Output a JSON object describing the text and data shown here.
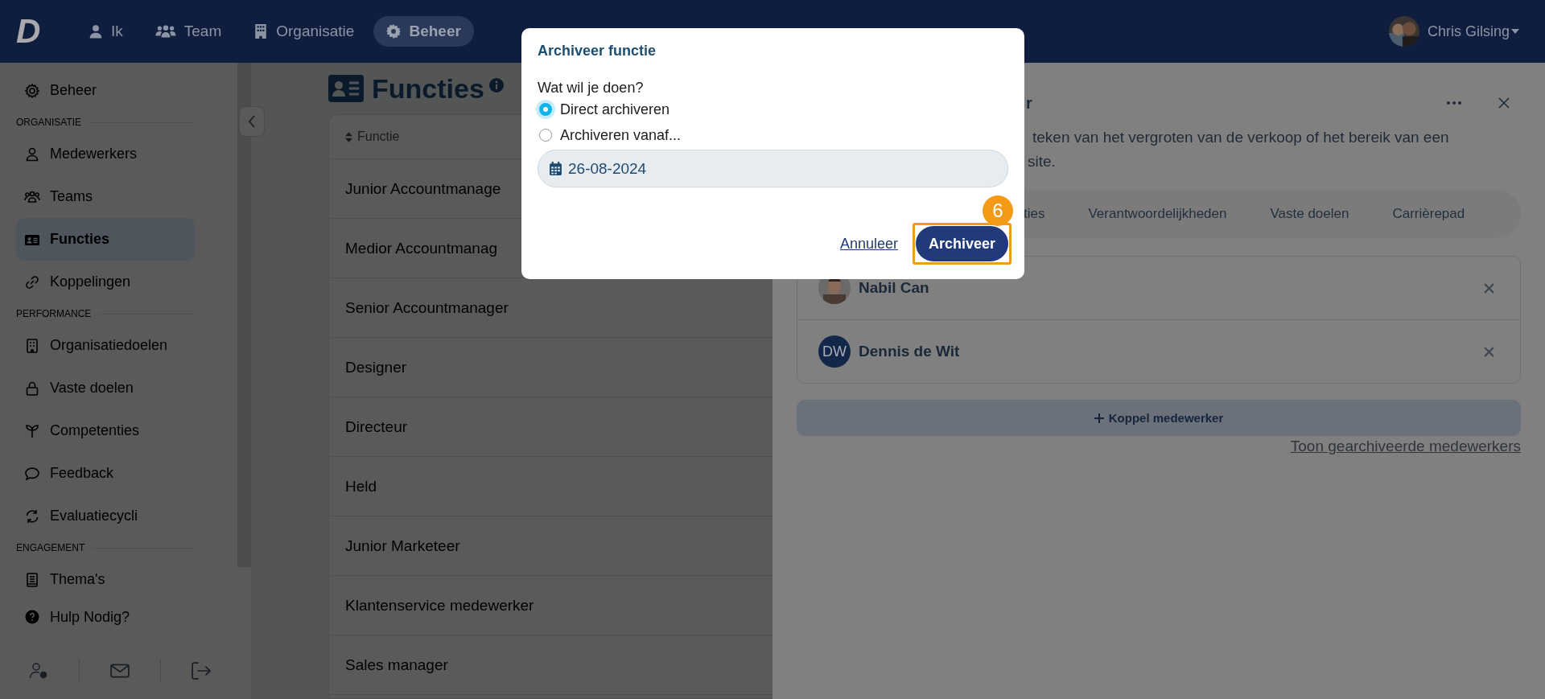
{
  "topbar": {
    "logo": "D",
    "nav": [
      {
        "label": "Ik",
        "selected": false
      },
      {
        "label": "Team",
        "selected": false
      },
      {
        "label": "Organisatie",
        "selected": false
      },
      {
        "label": "Beheer",
        "selected": true
      }
    ],
    "user": {
      "name": "Chris Gilsing"
    }
  },
  "sidebar": {
    "items": [
      {
        "kind": "link",
        "label": "Beheer",
        "selected": false
      },
      {
        "kind": "heading",
        "label": "ORGANISATIE"
      },
      {
        "kind": "link",
        "label": "Medewerkers",
        "selected": false
      },
      {
        "kind": "link",
        "label": "Teams",
        "selected": false
      },
      {
        "kind": "link",
        "label": "Functies",
        "selected": true
      },
      {
        "kind": "link",
        "label": "Koppelingen",
        "selected": false
      },
      {
        "kind": "heading",
        "label": "PERFORMANCE"
      },
      {
        "kind": "link",
        "label": "Organisatiedoelen",
        "selected": false
      },
      {
        "kind": "link",
        "label": "Vaste doelen",
        "selected": false
      },
      {
        "kind": "link",
        "label": "Competenties",
        "selected": false
      },
      {
        "kind": "link",
        "label": "Feedback",
        "selected": false
      },
      {
        "kind": "link",
        "label": "Evaluatiecycli",
        "selected": false
      },
      {
        "kind": "heading",
        "label": "ENGAGEMENT"
      },
      {
        "kind": "link",
        "label": "Thema's",
        "selected": false
      },
      {
        "kind": "link",
        "label": "Hulp Nodig?",
        "selected": false
      }
    ]
  },
  "page": {
    "title": "Functies",
    "table": {
      "columns": [
        "Functie"
      ],
      "rows": [
        "Junior Accountmanage",
        "Medior Accountmanag",
        "Senior Accountmanager",
        "Designer",
        "Directeur",
        "Held",
        "Junior Marketeer",
        "Klantenservice medewerker",
        "Sales manager"
      ]
    }
  },
  "detail_panel": {
    "title": "r",
    "description": [
      "teken van het vergroten van de verkoop of het bereik van een",
      "site."
    ],
    "tabs": [
      {
        "label": "ties",
        "selected": false
      },
      {
        "label": "Verantwoordelijkheden",
        "selected": false
      },
      {
        "label": "Vaste doelen",
        "selected": false
      },
      {
        "label": "Carrièrepad",
        "selected": false
      }
    ],
    "members": [
      {
        "name": "Nabil Can"
      },
      {
        "name": "Dennis de Wit",
        "kind": "initials",
        "initials": "DW"
      }
    ],
    "add_button": "Koppel medewerker",
    "archived_link": "Toon gearchiveerde medewerkers"
  },
  "dialog": {
    "title": "Archiveer functie",
    "question": "Wat wil je doen?",
    "options": [
      {
        "label": "Direct archiveren",
        "selected": true
      },
      {
        "label": "Archiveren vanaf...",
        "selected": false
      }
    ],
    "date": "26-08-2024",
    "cancel": "Annuleer",
    "confirm": "Archiveer",
    "step_badge": "6"
  }
}
